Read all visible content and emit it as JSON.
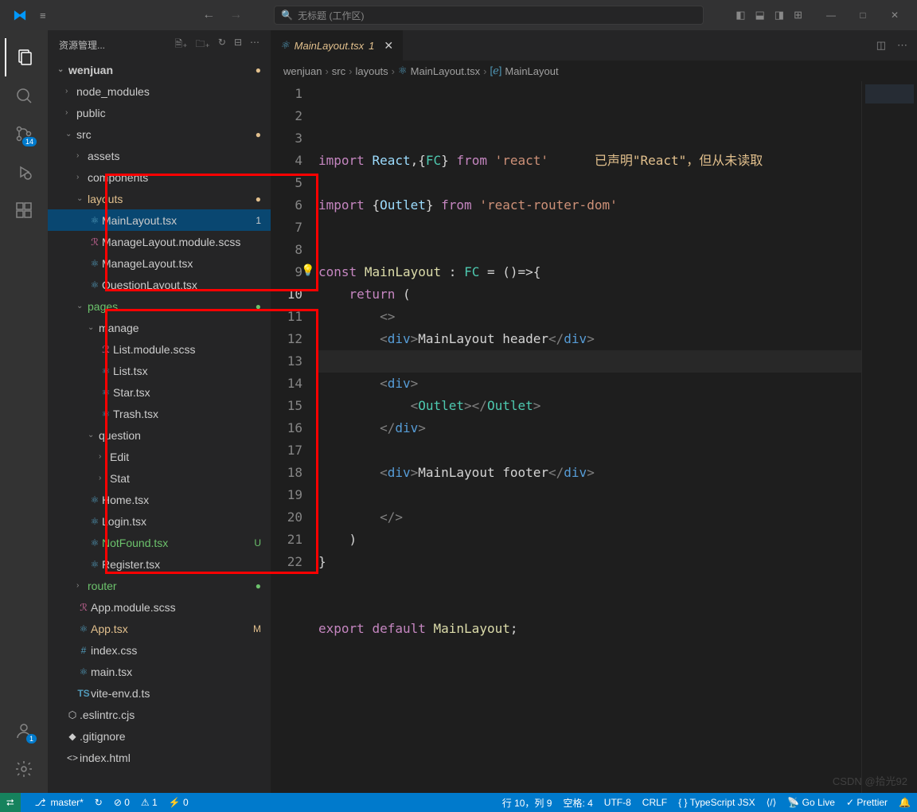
{
  "title_bar": {
    "search_placeholder": "无标题 (工作区)"
  },
  "sidebar": {
    "header": "资源管理...",
    "root": "wenjuan",
    "tree": [
      {
        "indent": 1,
        "type": "folder",
        "chev": "›",
        "label": "node_modules"
      },
      {
        "indent": 1,
        "type": "folder",
        "chev": "›",
        "label": "public"
      },
      {
        "indent": 1,
        "type": "folder",
        "chev": "⌄",
        "label": "src",
        "badge": "●",
        "badgeClass": "dot-yellow"
      },
      {
        "indent": 2,
        "type": "folder",
        "chev": "›",
        "label": "assets"
      },
      {
        "indent": 2,
        "type": "folder",
        "chev": "›",
        "label": "components"
      },
      {
        "indent": 2,
        "type": "folder",
        "chev": "⌄",
        "label": "layouts",
        "rowClass": "yellow",
        "badge": "●",
        "badgeClass": "dot-yellow"
      },
      {
        "indent": 3,
        "type": "file",
        "icon": "⚛",
        "iconClass": "icon-react",
        "label": "MainLayout.tsx",
        "rowClass": "selected",
        "badge": "1"
      },
      {
        "indent": 3,
        "type": "file",
        "icon": "ℛ",
        "iconClass": "icon-sass",
        "label": "ManageLayout.module.scss"
      },
      {
        "indent": 3,
        "type": "file",
        "icon": "⚛",
        "iconClass": "icon-react",
        "label": "ManageLayout.tsx"
      },
      {
        "indent": 3,
        "type": "file",
        "icon": "⚛",
        "iconClass": "icon-react",
        "label": "QuestionLayout.tsx"
      },
      {
        "indent": 2,
        "type": "folder",
        "chev": "⌄",
        "label": "pages",
        "rowClass": "green",
        "badge": "●",
        "badgeClass": "dot-green"
      },
      {
        "indent": 3,
        "type": "folder",
        "chev": "⌄",
        "label": "manage"
      },
      {
        "indent": 4,
        "type": "file",
        "icon": "ℛ",
        "iconClass": "icon-sass",
        "label": "List.module.scss"
      },
      {
        "indent": 4,
        "type": "file",
        "icon": "⚛",
        "iconClass": "icon-react",
        "label": "List.tsx"
      },
      {
        "indent": 4,
        "type": "file",
        "icon": "⚛",
        "iconClass": "icon-react",
        "label": "Star.tsx"
      },
      {
        "indent": 4,
        "type": "file",
        "icon": "⚛",
        "iconClass": "icon-react",
        "label": "Trash.tsx"
      },
      {
        "indent": 3,
        "type": "folder",
        "chev": "⌄",
        "label": "question"
      },
      {
        "indent": 4,
        "type": "folder",
        "chev": "›",
        "label": "Edit"
      },
      {
        "indent": 4,
        "type": "folder",
        "chev": "›",
        "label": "Stat"
      },
      {
        "indent": 3,
        "type": "file",
        "icon": "⚛",
        "iconClass": "icon-react",
        "label": "Home.tsx"
      },
      {
        "indent": 3,
        "type": "file",
        "icon": "⚛",
        "iconClass": "icon-react",
        "label": "Login.tsx"
      },
      {
        "indent": 3,
        "type": "file",
        "icon": "⚛",
        "iconClass": "icon-react",
        "label": "NotFound.tsx",
        "rowClass": "green",
        "badge": "U"
      },
      {
        "indent": 3,
        "type": "file",
        "icon": "⚛",
        "iconClass": "icon-react",
        "label": "Register.tsx"
      },
      {
        "indent": 2,
        "type": "folder",
        "chev": "›",
        "label": "router",
        "rowClass": "green",
        "badge": "●",
        "badgeClass": "dot-green"
      },
      {
        "indent": 2,
        "type": "file",
        "icon": "ℛ",
        "iconClass": "icon-sass",
        "label": "App.module.scss"
      },
      {
        "indent": 2,
        "type": "file",
        "icon": "⚛",
        "iconClass": "icon-react",
        "label": "App.tsx",
        "rowClass": "yellow",
        "badge": "M"
      },
      {
        "indent": 2,
        "type": "file",
        "icon": "#",
        "iconClass": "icon-css",
        "label": "index.css"
      },
      {
        "indent": 2,
        "type": "file",
        "icon": "⚛",
        "iconClass": "icon-react",
        "label": "main.tsx"
      },
      {
        "indent": 2,
        "type": "file",
        "icon": "TS",
        "iconClass": "icon-ts",
        "label": "vite-env.d.ts"
      },
      {
        "indent": 1,
        "type": "file",
        "icon": "⬡",
        "iconClass": "",
        "label": ".eslintrc.cjs"
      },
      {
        "indent": 1,
        "type": "file",
        "icon": "◆",
        "iconClass": "",
        "label": ".gitignore"
      },
      {
        "indent": 1,
        "type": "file",
        "icon": "<>",
        "iconClass": "",
        "label": "index.html"
      }
    ]
  },
  "activity": {
    "scm_badge": "14",
    "accounts_badge": "1"
  },
  "tab": {
    "label": "MainLayout.tsx",
    "modified": "1"
  },
  "breadcrumb": [
    "wenjuan",
    "src",
    "layouts",
    "MainLayout.tsx",
    "MainLayout"
  ],
  "code": {
    "warning": "已声明\"React\"，但从未读取",
    "lines": 22
  },
  "status": {
    "branch": "master*",
    "sync": "↻",
    "errors": "⊘ 0",
    "warnings": "⚠ 1",
    "port": "⚡ 0",
    "line_col": "行 10，列 9",
    "spaces": "空格: 4",
    "encoding": "UTF-8",
    "eol": "CRLF",
    "lang": "TypeScript JSX",
    "golive": "Go Live",
    "prettier": "Prettier"
  },
  "watermark": "CSDN @拾光92"
}
